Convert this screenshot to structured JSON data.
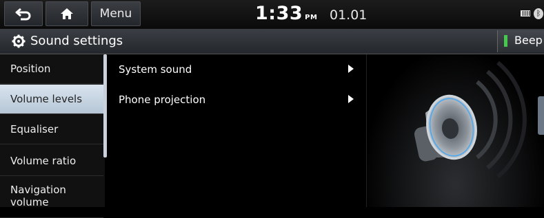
{
  "status_bar": {
    "menu_label": "Menu",
    "time": "1:33",
    "ampm": "PM",
    "date": "01.01",
    "icons": [
      "back-icon",
      "home-icon",
      "battery-icon",
      "bluetooth-icon"
    ]
  },
  "title_bar": {
    "title": "Sound settings",
    "beep_label": "Beep",
    "beep_indicator_color": "#46c84c"
  },
  "sidebar": {
    "items": [
      {
        "label": "Position",
        "active": false
      },
      {
        "label": "Volume levels",
        "active": true
      },
      {
        "label": "Equaliser",
        "active": false
      },
      {
        "label": "Volume ratio",
        "active": false
      },
      {
        "label": "Navigation volume",
        "active": false
      }
    ]
  },
  "list": {
    "items": [
      {
        "label": "System sound"
      },
      {
        "label": "Phone projection"
      }
    ]
  },
  "colors": {
    "active_item": "#c8d5e2",
    "accent_ring": "#5aa9e6"
  }
}
